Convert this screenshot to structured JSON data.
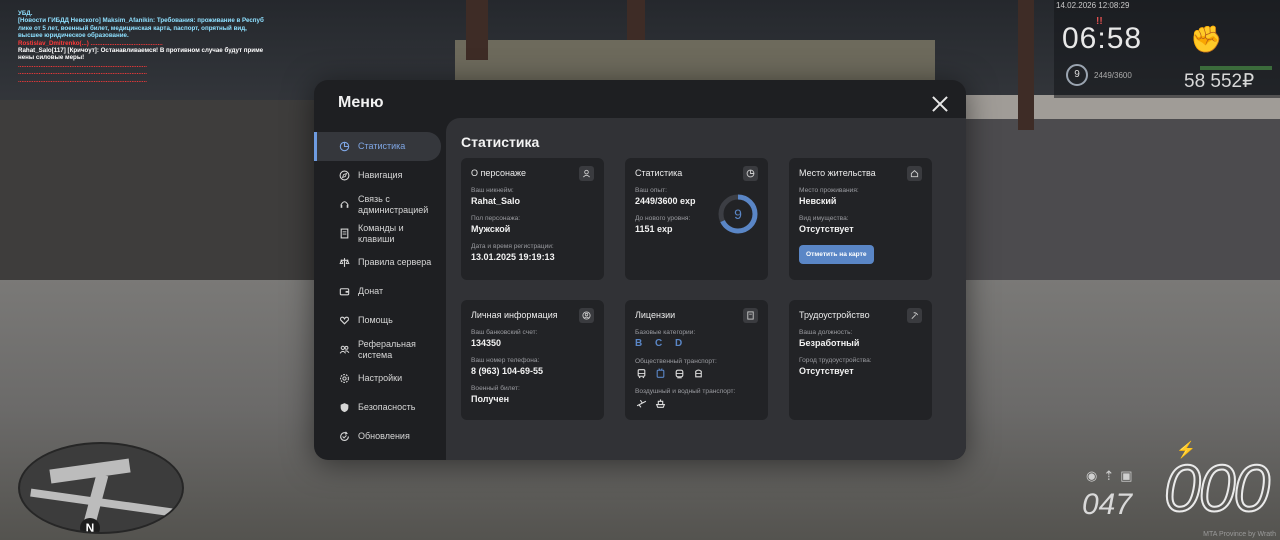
{
  "chat": [
    {
      "text": "УБД.",
      "color": "#8ee0ff"
    },
    {
      "text": "[Новости ГИБДД Невского] Maksim_Afanikin: Требования: проживание в Респуб",
      "color": "#8ee0ff"
    },
    {
      "text": "лике от 5 лет, военный билет, медицинская карта, паспорт, опрятный вид,",
      "color": "#8ee0ff"
    },
    {
      "text": "высшее юридическое образование.",
      "color": "#8ee0ff"
    },
    {
      "text": "Rostislav_Dmitrenko(...) ..........................................",
      "color": "#ff3a3a"
    },
    {
      "text": "Rahat_Salo[117] [Кричоут]: Останавливаемся! В противном случае будут приме",
      "color": "#ffffff"
    },
    {
      "text": "нены силовые меры!",
      "color": "#ffffff"
    },
    {
      "text": "...........................................................................",
      "color": "#ff3a3a"
    },
    {
      "text": "...........................................................................",
      "color": "#ff3a3a"
    },
    {
      "text": "...........................................................................",
      "color": "#ff3a3a"
    }
  ],
  "hud": {
    "datetime": "14.02.2026 12:08:29",
    "alarm": "!!",
    "time": "06:58",
    "level": "9",
    "exp": "2449/3600",
    "money": "58 552₽"
  },
  "minimap": {
    "north": "N"
  },
  "speedometer": {
    "speed": "000",
    "fuel": "047"
  },
  "watermark": "MTA Province by Wrath",
  "menu": {
    "title": "Меню",
    "nav": [
      {
        "label": "Статистика",
        "icon": "stats-icon"
      },
      {
        "label": "Навигация",
        "icon": "compass-icon"
      },
      {
        "label": "Связь с администрацией",
        "icon": "headset-icon"
      },
      {
        "label": "Команды и клавиши",
        "icon": "document-icon"
      },
      {
        "label": "Правила сервера",
        "icon": "scales-icon"
      },
      {
        "label": "Донат",
        "icon": "wallet-icon"
      },
      {
        "label": "Помощь",
        "icon": "heart-hand-icon"
      },
      {
        "label": "Реферальная система",
        "icon": "people-icon"
      },
      {
        "label": "Настройки",
        "icon": "gear-icon"
      },
      {
        "label": "Безопасность",
        "icon": "shield-icon"
      },
      {
        "label": "Обновления",
        "icon": "refresh-icon"
      }
    ],
    "content_title": "Статистика",
    "character": {
      "heading": "О персонаже",
      "nick_label": "Ваш никнейм:",
      "nick": "Rahat_Salo",
      "gender_label": "Пол персонажа:",
      "gender": "Мужской",
      "reg_label": "Дата и время регистрации:",
      "reg": "13.01.2025 19:19:13"
    },
    "stats": {
      "heading": "Статистика",
      "exp_label": "Ваш опыт:",
      "exp": "2449/3600 exp",
      "next_label": "До нового уровня:",
      "next": "1151 exp",
      "level": "9",
      "progress": 0.68
    },
    "residence": {
      "heading": "Место жительства",
      "place_label": "Место проживания:",
      "place": "Невский",
      "property_label": "Вид имущества:",
      "property": "Отсутствует",
      "button": "Отметить на карте"
    },
    "personal": {
      "heading": "Личная информация",
      "bank_label": "Ваш банковский счет:",
      "bank": "134350",
      "phone_label": "Ваш номер телефона:",
      "phone": "8 (963) 104-69-55",
      "military_label": "Военный билет:",
      "military": "Получен"
    },
    "licenses": {
      "heading": "Лицензии",
      "base_label": "Базовые категории:",
      "base": "B C D",
      "public_label": "Общественный транспорт:",
      "air_label": "Воздушный и водный транспорт:"
    },
    "employment": {
      "heading": "Трудоустройство",
      "position_label": "Ваша должность:",
      "position": "Безработный",
      "city_label": "Город трудоустройства:",
      "city": "Отсутствует"
    }
  }
}
